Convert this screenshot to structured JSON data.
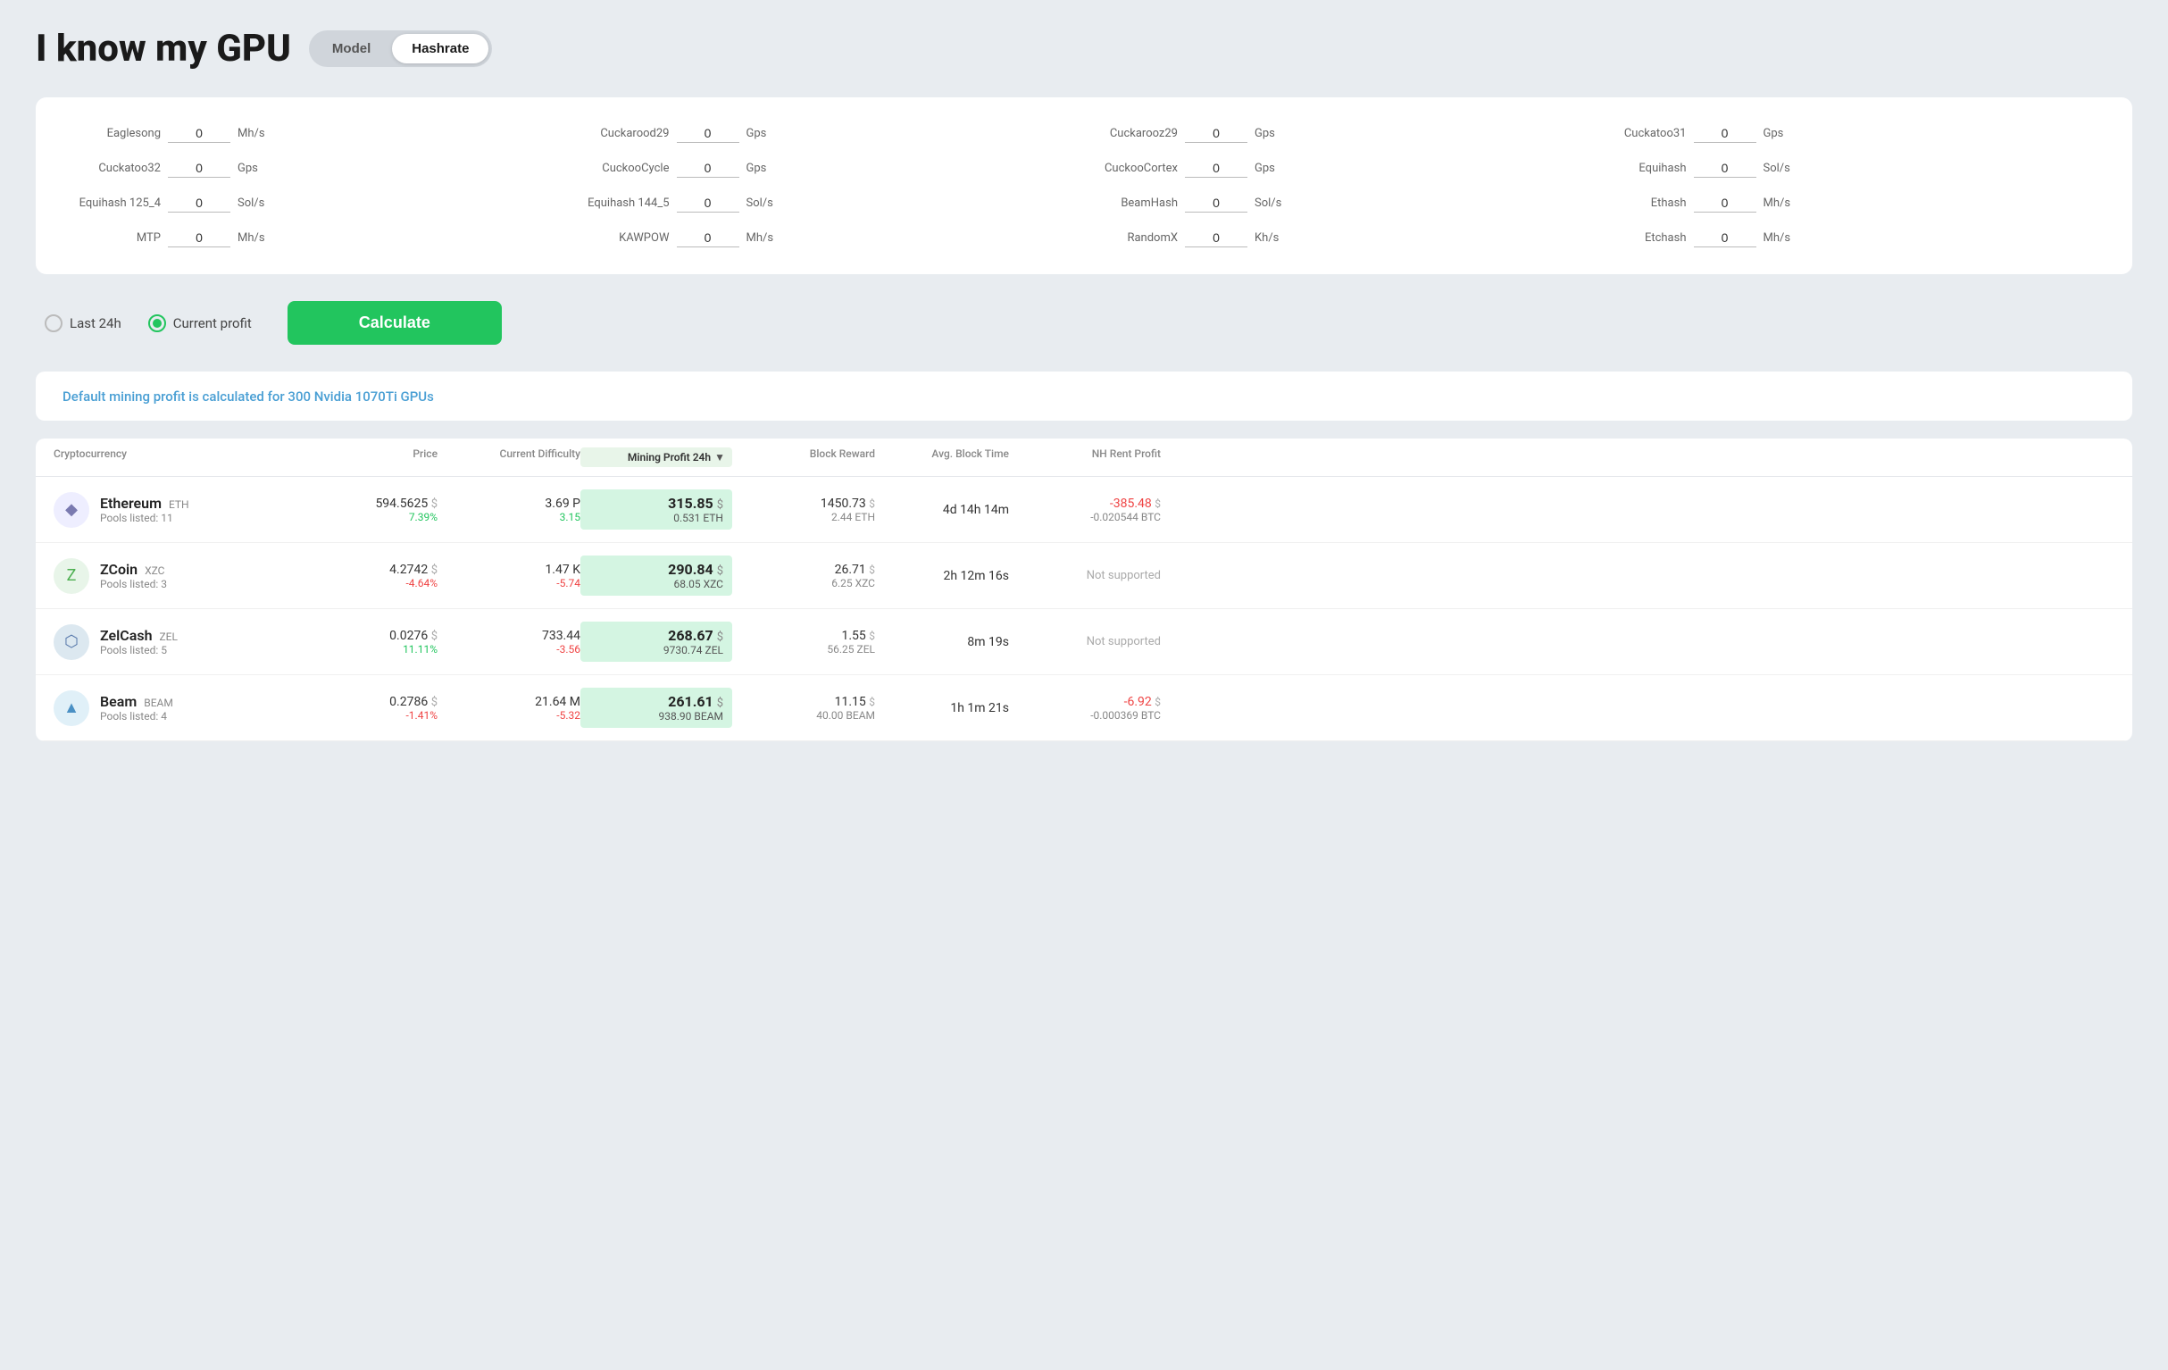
{
  "header": {
    "title": "I know my GPU",
    "tabs": [
      {
        "id": "model",
        "label": "Model",
        "active": false
      },
      {
        "id": "hashrate",
        "label": "Hashrate",
        "active": true
      }
    ]
  },
  "hashrate_fields": [
    {
      "id": "eaglesong",
      "label": "Eaglesong",
      "value": "0",
      "unit": "Mh/s"
    },
    {
      "id": "cuckarood29",
      "label": "Cuckarood29",
      "value": "0",
      "unit": "Gps"
    },
    {
      "id": "cuckarooz29",
      "label": "Cuckarooz29",
      "value": "0",
      "unit": "Gps"
    },
    {
      "id": "cuckatoo31",
      "label": "Cuckatoo31",
      "value": "0",
      "unit": "Gps"
    },
    {
      "id": "cuckatoo32",
      "label": "Cuckatoo32",
      "value": "0",
      "unit": "Gps"
    },
    {
      "id": "cuckoo_cycle",
      "label": "CuckooCycle",
      "value": "0",
      "unit": "Gps"
    },
    {
      "id": "cuckoo_cortex",
      "label": "CuckooCortex",
      "value": "0",
      "unit": "Gps"
    },
    {
      "id": "equihash",
      "label": "Equihash",
      "value": "0",
      "unit": "Sol/s"
    },
    {
      "id": "equihash_125_4",
      "label": "Equihash 125_4",
      "value": "0",
      "unit": "Sol/s"
    },
    {
      "id": "equihash_144_5",
      "label": "Equihash 144_5",
      "value": "0",
      "unit": "Sol/s"
    },
    {
      "id": "beamhash",
      "label": "BeamHash",
      "value": "0",
      "unit": "Sol/s"
    },
    {
      "id": "ethash",
      "label": "Ethash",
      "value": "0",
      "unit": "Mh/s"
    },
    {
      "id": "mtp",
      "label": "MTP",
      "value": "0",
      "unit": "Mh/s"
    },
    {
      "id": "kawpow",
      "label": "KAWPOW",
      "value": "0",
      "unit": "Mh/s"
    },
    {
      "id": "randomx",
      "label": "RandomX",
      "value": "0",
      "unit": "Kh/s"
    },
    {
      "id": "etchash",
      "label": "Etchash",
      "value": "0",
      "unit": "Mh/s"
    }
  ],
  "controls": {
    "radio_last24h": "Last 24h",
    "radio_current": "Current profit",
    "calculate_label": "Calculate",
    "selected": "current"
  },
  "info_banner": {
    "text": "Default mining profit is calculated for 300 Nvidia 1070Ti GPUs"
  },
  "table": {
    "headers": [
      {
        "id": "crypto",
        "label": "Cryptocurrency"
      },
      {
        "id": "price",
        "label": "Price"
      },
      {
        "id": "difficulty",
        "label": "Current Difficulty"
      },
      {
        "id": "profit",
        "label": "Mining Profit 24h",
        "sort": true
      },
      {
        "id": "block_reward",
        "label": "Block Reward"
      },
      {
        "id": "block_time",
        "label": "Avg. Block Time"
      },
      {
        "id": "nh_profit",
        "label": "NH Rent Profit"
      }
    ],
    "rows": [
      {
        "id": "ethereum",
        "name": "Ethereum",
        "symbol": "ETH",
        "pools": "11",
        "icon": "eth",
        "price": "594.5625",
        "price_change": "7.39%",
        "price_change_dir": "up",
        "difficulty": "3.69 P",
        "diff_change": "3.15",
        "diff_change_dir": "up",
        "profit": "315.85",
        "profit_sub": "0.531 ETH",
        "block_reward": "1450.73",
        "block_reward_sub": "2.44 ETH",
        "block_time": "4d 14h 14m",
        "nh_profit": "-385.48",
        "nh_profit_sub": "-0.020544 BTC",
        "nh_supported": true
      },
      {
        "id": "zcoin",
        "name": "ZCoin",
        "symbol": "XZC",
        "pools": "3",
        "icon": "zcoin",
        "price": "4.2742",
        "price_change": "-4.64%",
        "price_change_dir": "down",
        "difficulty": "1.47 K",
        "diff_change": "-5.74",
        "diff_change_dir": "down",
        "profit": "290.84",
        "profit_sub": "68.05 XZC",
        "block_reward": "26.71",
        "block_reward_sub": "6.25 XZC",
        "block_time": "2h 12m 16s",
        "nh_profit": null,
        "nh_profit_sub": null,
        "nh_supported": false
      },
      {
        "id": "zelcash",
        "name": "ZelCash",
        "symbol": "ZEL",
        "pools": "5",
        "icon": "zel",
        "price": "0.0276",
        "price_change": "11.11%",
        "price_change_dir": "up",
        "difficulty": "733.44",
        "diff_change": "-3.56",
        "diff_change_dir": "down",
        "profit": "268.67",
        "profit_sub": "9730.74 ZEL",
        "block_reward": "1.55",
        "block_reward_sub": "56.25 ZEL",
        "block_time": "8m 19s",
        "nh_profit": null,
        "nh_profit_sub": null,
        "nh_supported": false
      },
      {
        "id": "beam",
        "name": "Beam",
        "symbol": "BEAM",
        "pools": "4",
        "icon": "beam",
        "price": "0.2786",
        "price_change": "-1.41%",
        "price_change_dir": "down",
        "difficulty": "21.64 M",
        "diff_change": "-5.32",
        "diff_change_dir": "down",
        "profit": "261.61",
        "profit_sub": "938.90 BEAM",
        "block_reward": "11.15",
        "block_reward_sub": "40.00 BEAM",
        "block_time": "1h 1m 21s",
        "nh_profit": "-6.92",
        "nh_profit_sub": "-0.000369 BTC",
        "nh_supported": true
      }
    ],
    "not_supported_label": "Not supported"
  }
}
